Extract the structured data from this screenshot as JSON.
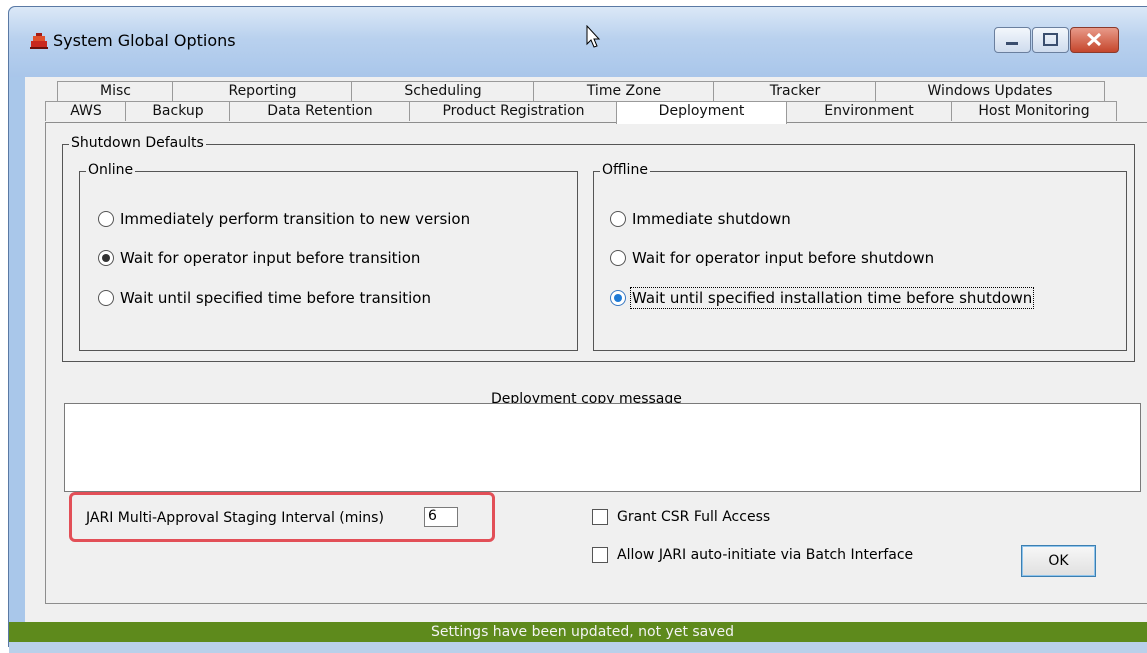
{
  "window": {
    "title": "System Global Options"
  },
  "tabs": {
    "top_row": [
      "Misc",
      "Reporting",
      "Scheduling",
      "Time Zone",
      "Tracker",
      "Windows Updates"
    ],
    "bottom_row": [
      "AWS",
      "Backup",
      "Data Retention",
      "Product Registration",
      "Deployment",
      "Environment",
      "Host Monitoring"
    ],
    "active": "Deployment"
  },
  "shutdown_defaults": {
    "label": "Shutdown Defaults",
    "online": {
      "label": "Online",
      "options": [
        {
          "label": "Immediately perform transition to new version",
          "checked": false
        },
        {
          "label": "Wait for operator input before transition",
          "checked": true
        },
        {
          "label": "Wait until specified time before transition",
          "checked": false
        }
      ]
    },
    "offline": {
      "label": "Offline",
      "options": [
        {
          "label": "Immediate shutdown",
          "checked": false
        },
        {
          "label": "Wait for operator input before shutdown",
          "checked": false
        },
        {
          "label": "Wait until specified installation time before shutdown",
          "checked": true
        }
      ]
    }
  },
  "deployment_copy_message": {
    "label": "Deployment copy message",
    "value": ""
  },
  "jari": {
    "label": "JARI Multi-Approval Staging Interval (mins)",
    "value": "6"
  },
  "checkboxes": {
    "grant_csr": {
      "label": "Grant CSR Full Access",
      "checked": false
    },
    "allow_jari": {
      "label": "Allow JARI auto-initiate via Batch Interface",
      "checked": false
    }
  },
  "ok_button": {
    "label": "OK"
  },
  "status": {
    "text": "Settings have been updated, not yet saved"
  },
  "colors": {
    "status_bar": "#5e8a1c",
    "highlight": "#e24f57",
    "titlebar": "#a9c6ea"
  },
  "icons": [
    "app-icon",
    "cursor-icon",
    "minimize-icon",
    "maximize-icon",
    "close-icon"
  ]
}
